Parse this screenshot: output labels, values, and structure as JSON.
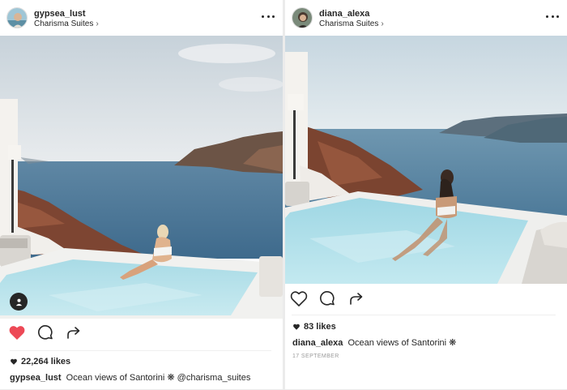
{
  "posts": [
    {
      "username": "gypsea_lust",
      "location": "Charisma Suites",
      "likes": "22,264 likes",
      "caption_user": "gypsea_lust",
      "caption_text": "Ocean views of Santorini",
      "caption_emoji": "❋",
      "caption_mention": "@charisma_suites",
      "liked": true,
      "icons": [
        "more-options-icon",
        "user-tag-icon",
        "heart-icon",
        "comment-icon",
        "share-icon"
      ]
    },
    {
      "username": "diana_alexa",
      "location": "Charisma Suites",
      "likes": "83 likes",
      "caption_user": "diana_alexa",
      "caption_text": "Ocean views of Santorini",
      "caption_emoji": "❋",
      "date": "17 SEPTEMBER",
      "liked": false,
      "icons": [
        "more-options-icon",
        "heart-icon",
        "comment-icon",
        "share-icon"
      ]
    }
  ],
  "colors": {
    "like_red": "#ed4956",
    "text": "#262626",
    "muted": "#999999",
    "background": "#ebebeb"
  }
}
